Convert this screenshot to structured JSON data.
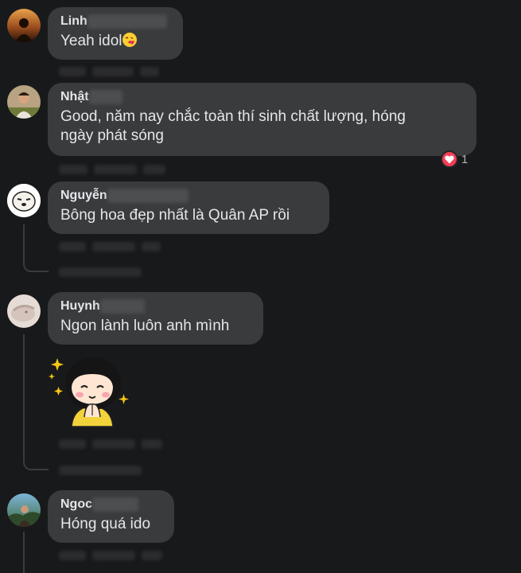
{
  "comments": [
    {
      "name": "Linh",
      "text": "Yeah idol",
      "emoji_icon": "kissing-face-icon"
    },
    {
      "name": "Nhật",
      "text_line1": "Good, năm nay chắc toàn thí sinh chất lượng, hóng",
      "text_line2": "ngày phát sóng",
      "reaction_icon": "love-reaction-icon",
      "reaction_count": "1"
    },
    {
      "name": "Nguyễn",
      "text": "Bông hoa đẹp nhất là Quân AP rồi"
    },
    {
      "name": "Huynh",
      "text": "Ngon lành luôn anh mình",
      "sticker_icon": "girl-sticker-icon"
    },
    {
      "name": "Ngoc",
      "text": "Hóng quá ido"
    }
  ],
  "colors": {
    "background": "#18191a",
    "bubble": "#3a3b3c",
    "text": "#e4e6eb",
    "love": "#f33e58"
  }
}
